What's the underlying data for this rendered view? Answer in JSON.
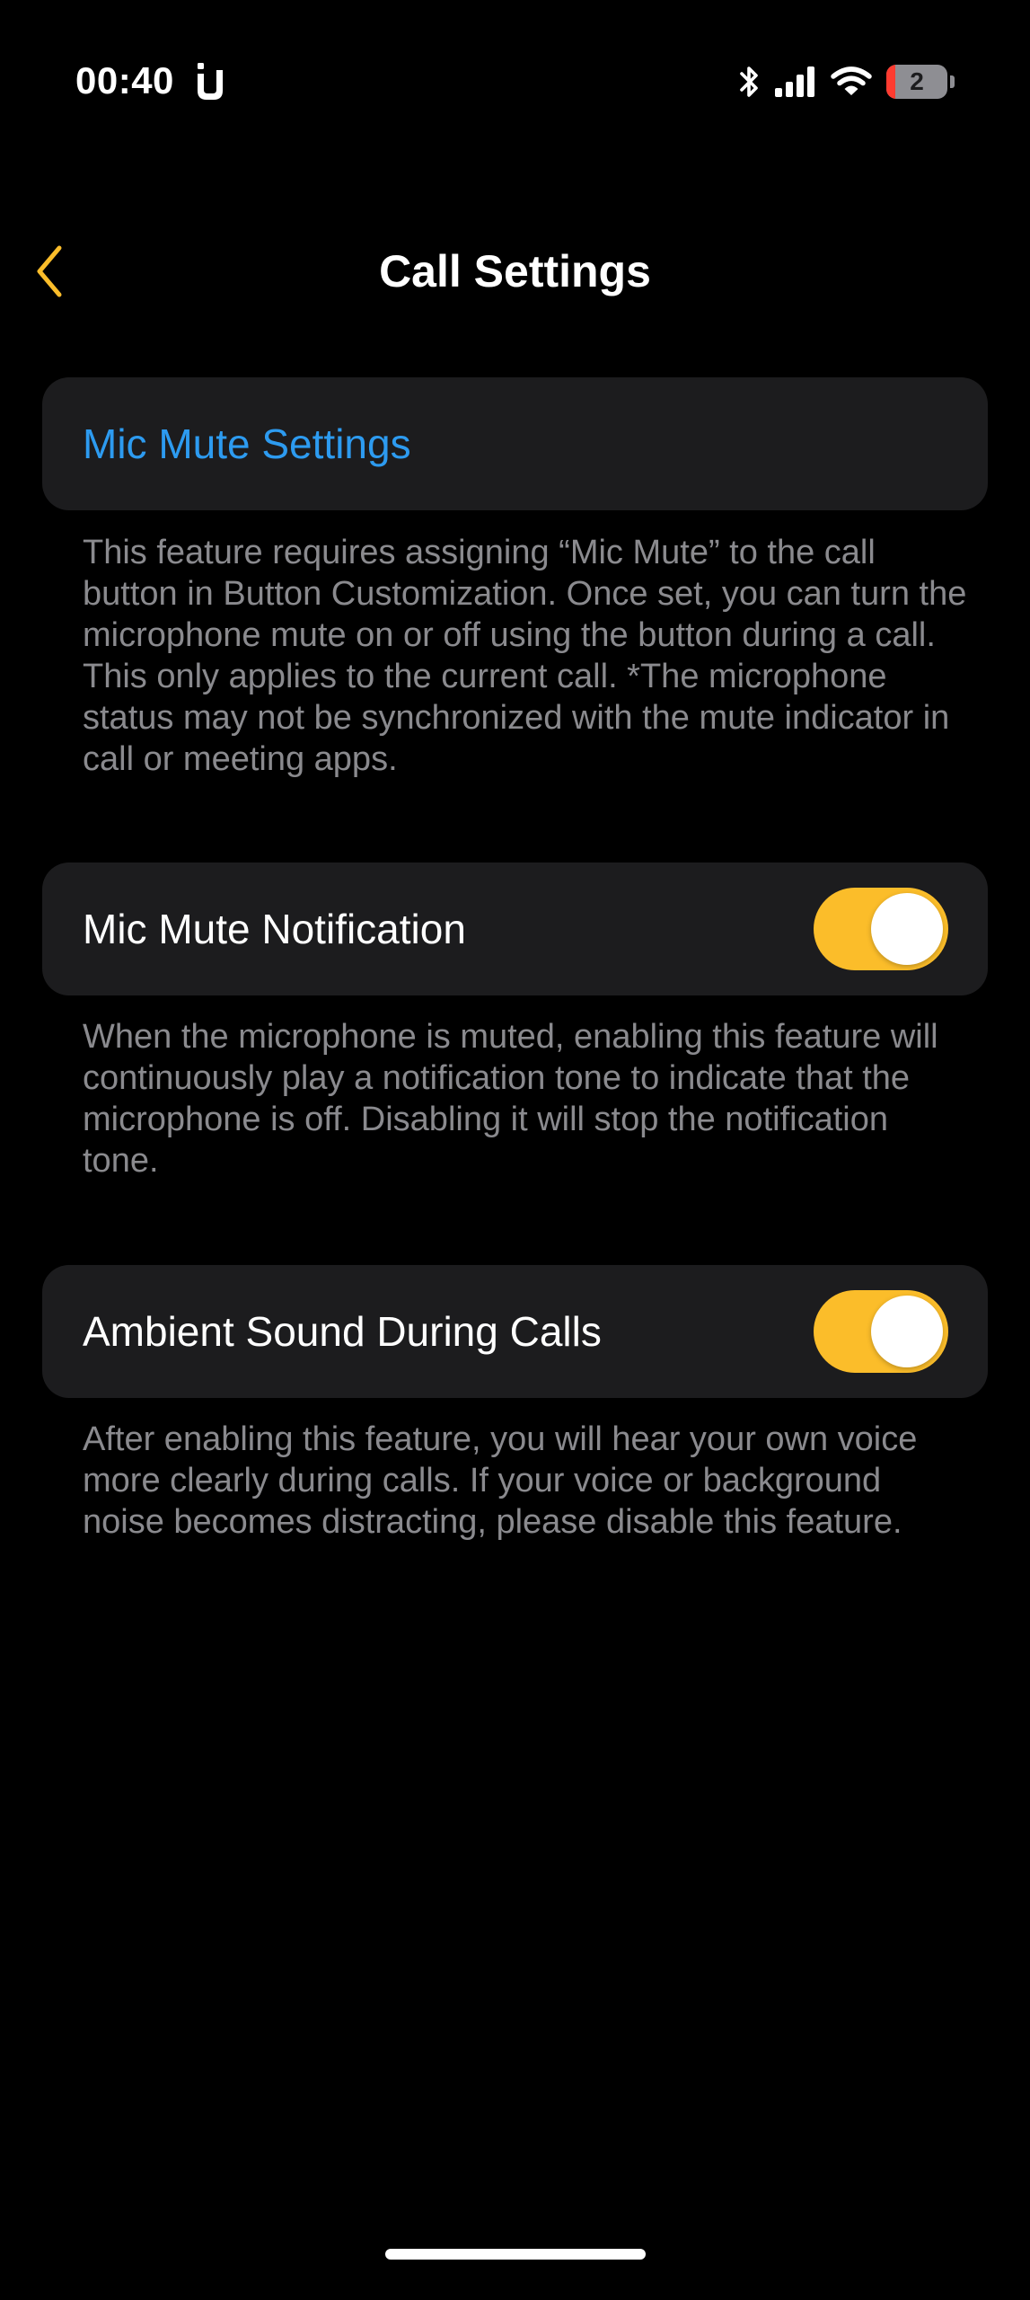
{
  "status_bar": {
    "time": "00:40",
    "battery_level": "2",
    "battery_fraction": 0.02,
    "icons": [
      "app-notification-icon",
      "bluetooth-icon",
      "cellular-signal-icon",
      "wifi-icon",
      "battery-icon"
    ]
  },
  "nav": {
    "title": "Call Settings",
    "back_icon": "chevron-left-icon"
  },
  "sections": {
    "mic_mute_settings": {
      "label": "Mic Mute Settings",
      "description": "This feature requires assigning “Mic Mute” to the call button in Button Customization. Once set, you can turn the microphone mute on or off using the button during a call. This only applies to the current call. *The microphone status may not be synchronized with the mute indicator in call or meeting apps."
    },
    "mic_mute_notification": {
      "label": "Mic Mute Notification",
      "enabled": true,
      "description": "When the microphone is muted, enabling this feature will continuously play a notification tone to indicate that the microphone is off. Disabling it will stop the notification tone."
    },
    "ambient_sound": {
      "label": "Ambient Sound During Calls",
      "enabled": true,
      "description": "After enabling this feature, you will hear your own voice more clearly during calls. If your voice or background noise becomes distracting, please disable this feature."
    }
  },
  "colors": {
    "background": "#000000",
    "card": "#1c1c1e",
    "accent": "#fbbd2a",
    "link": "#2d9bf0",
    "secondary_text": "#8a8a8e"
  }
}
